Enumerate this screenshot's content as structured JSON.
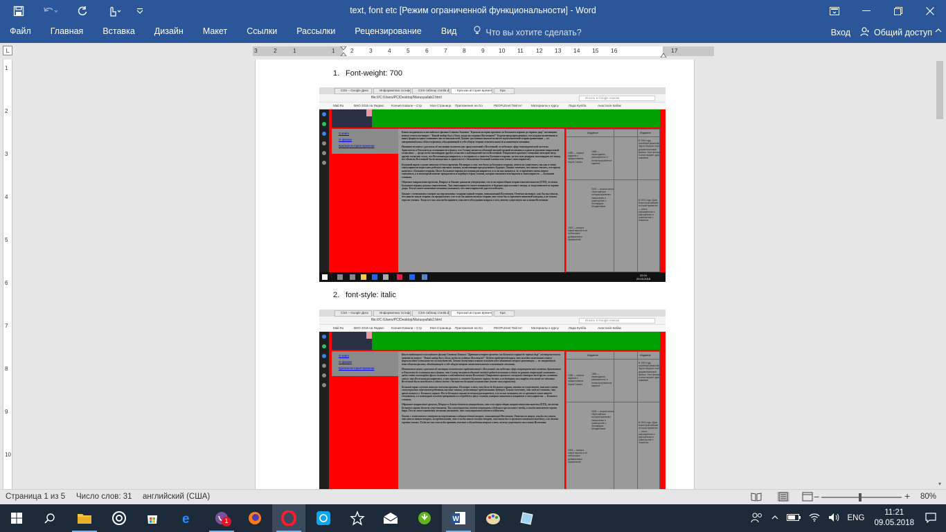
{
  "window": {
    "title": "text, font etc [Режим ограниченной функциональности] - Word"
  },
  "qat": {
    "icons": [
      "save-icon",
      "undo-icon",
      "redo-icon",
      "touch-mode-icon",
      "customize-icon"
    ]
  },
  "ribbon": {
    "tabs": [
      "Файл",
      "Главная",
      "Вставка",
      "Дизайн",
      "Макет",
      "Ссылки",
      "Рассылки",
      "Рецензирование",
      "Вид"
    ],
    "tell_me": "Что вы хотите сделать?",
    "signin": "Вход",
    "share": "Общий доступ"
  },
  "ruler": {
    "corner": "L",
    "h_numbers": [
      "3",
      "2",
      "1",
      "1",
      "2",
      "3",
      "4",
      "5",
      "6",
      "7",
      "8",
      "9",
      "10",
      "11",
      "12",
      "13",
      "14",
      "15",
      "16",
      "17"
    ],
    "v_numbers": [
      "1",
      "2",
      "3",
      "4",
      "5",
      "6",
      "7",
      "8",
      "9",
      "10"
    ]
  },
  "document": {
    "items": [
      {
        "num": "1.",
        "text": "Font-weight: 700"
      },
      {
        "num": "2.",
        "text": "font-style: italic"
      }
    ],
    "shot": {
      "tabs": [
        "CSS – Google Диск",
        "Информатика та інформ",
        "CSS-таблиці стилів.doc",
        "Краткая история времен",
        "Кра"
      ],
      "url": "file:///C:/Users/PC/Desktop/Marusya/lab2.html",
      "search_placeholder": "Искать в Google поиске",
      "bookmarks": [
        "Mail.Ru",
        "ВНО 2015 на Яндекс",
        "Ксения Ковали – Стр",
        "Моя Страница",
        "Приложения на Go",
        "PEOPLEnet Твій Інт",
        "Материалы к курсу",
        "Лада Куліба",
        "Анастасія Кабак"
      ],
      "nav_links": [
        "О книге",
        "О физике",
        "Краткая история времени"
      ],
      "table_headers": [
        "Издание",
        "Издание"
      ],
      "clock_time": "22:04",
      "clock_date": "29.03.2018",
      "paragraphs": [
        "Книга выдающегося английского физика Стивена Хокинга \"Краткая история времени: от Большого взрыва до черных дыр\" посвящена поиску ответа на вопрос: \"Какой выбор был у Бога, когда он создавал Вселенную?\" Будучи предупрежденным, что каждая включенная в книгу формула вдвое уменьшит число покупателей, Хокинг доступным языком излагает идеи квантовой теории гравитации — не завершенной пока области физики, объединяющей в себе общую теорию относительности и квантовую механику.",
        "Начинается книга с рассказа об эволюции человеческих представлений о Вселенной: от небесных сфер геоцентрической системы Аристотеля и Птолемея до осознания того факта, что Солнце является обычной звездой средней величины в одном из рукавов спиральной галактики — среди сотен миллиардов других галактик в наблюдаемой части Вселенной. Открытием красного смещения спектров звезд других галактик стало, что Вселенная расширяется, а это привело к гипотезе Большого взрыва: десять или двадцать миллиардов лет назад все объекты Вселенной были находились в одном месте с бесконечно большой плотностью (точке сингулярности).",
        "Большой взрыв служит началом отсчета времени. На вопрос о том, что было до Большого взрыва, ответа не существует, так как в точке сингулярности перестают работать научные законы, позволяющие предсказывать будущее; Хокинг замечает, что можно считать, что время началось с Большого взрыва. После Большого взрыва вселенная расширяется, и если она замкнута, то со временем снова начнет сжиматься, а в некоторый момент прекратится и перейдет в фазу сжатия, которая закончится возвратом в сингулярность — Большим хлопком.",
        "Обратное направление времени, Пенроуз и Хокинг доказали утверждение, что если верна общая теория относительности (ОТО), то точка Большого взрыва должна существовать. Так сингулярность может возникнуть в будущем при коллапсе звезды, и тогда появляется черная дыра. Тем не менее квантовая механика указывает, что сингулярностей удастся избежать.",
        "Хокинг с оптимизмом смотрит на перспективы создания единой теории, описывающей Вселенную. Отвечая на вопрос, как бы мы узнали, что нашли такую теорию, он предполагает, что если бы нашли полную теорию, она стала бы со временем понятной каждому, а не только горстке ученых. Тогда все мы смогли бы принять участие в обсуждении вопроса о том, почему существуем мы и наша Вселенная."
      ],
      "table_cells": [
        "1988 — первое издание с предисловием Карла Сагана",
        "1988 — переиздание, расширенное и иллюстрированное издание",
        "В 1991 году покойный режиссёр Эррол Моррис снял документальный фильм. Этот фильм в книге вышел одно название",
        "1993 — выпуск новой версии в её небольшим добавлением примечаний",
        "2005 — вышла книга «Кратчайшая история времени», написанная в соавторстве с Леонардом Млодиновым",
        "В 2001 году «Дом Книги Кратчайшей истории времени» — книга, расширенная и упрощённая в соавторстве с Хокингом"
      ]
    }
  },
  "status": {
    "page": "Страница 1 из 5",
    "words": "Число слов: 31",
    "language": "английский (США)",
    "zoom": "80%"
  },
  "taskbar": {
    "apps": [
      "start-icon",
      "search-icon",
      "file-explorer-icon",
      "chrome-icon",
      "store-icon",
      "edge-icon",
      "viber-icon",
      "firefox-icon",
      "opera-icon",
      "camera-app-icon",
      "star-icon",
      "mail-icon",
      "utorrent-icon",
      "word-icon",
      "paint-icon",
      "notes-icon"
    ],
    "viber_badge": "1",
    "lang": "ENG",
    "time": "11:21",
    "date": "09.05.2018"
  },
  "colors": {
    "ribbon": "#2b579a",
    "taskbar": "#1c2a3a",
    "page_red": "#ff0000",
    "page_green": "#00a000"
  }
}
